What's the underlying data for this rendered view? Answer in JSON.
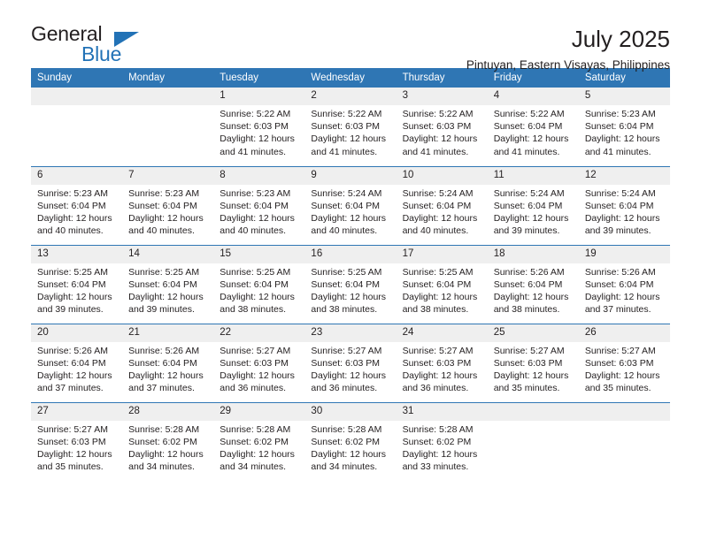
{
  "logo": {
    "text_top": "General",
    "text_bottom": "Blue",
    "icon": "triangle-icon",
    "color_primary": "#2272b6",
    "color_text": "#231f20"
  },
  "header": {
    "title": "July 2025",
    "subtitle": "Pintuyan, Eastern Visayas, Philippines"
  },
  "colors": {
    "header_row_bg": "#2f76b4",
    "daynum_bg": "#efefef",
    "row_divider": "#2f76b4",
    "text": "#231f20"
  },
  "weekday_headers": [
    "Sunday",
    "Monday",
    "Tuesday",
    "Wednesday",
    "Thursday",
    "Friday",
    "Saturday"
  ],
  "weeks": [
    [
      {
        "day": "",
        "info": ""
      },
      {
        "day": "",
        "info": ""
      },
      {
        "day": "1",
        "info": "Sunrise: 5:22 AM\nSunset: 6:03 PM\nDaylight: 12 hours\nand 41 minutes."
      },
      {
        "day": "2",
        "info": "Sunrise: 5:22 AM\nSunset: 6:03 PM\nDaylight: 12 hours\nand 41 minutes."
      },
      {
        "day": "3",
        "info": "Sunrise: 5:22 AM\nSunset: 6:03 PM\nDaylight: 12 hours\nand 41 minutes."
      },
      {
        "day": "4",
        "info": "Sunrise: 5:22 AM\nSunset: 6:04 PM\nDaylight: 12 hours\nand 41 minutes."
      },
      {
        "day": "5",
        "info": "Sunrise: 5:23 AM\nSunset: 6:04 PM\nDaylight: 12 hours\nand 41 minutes."
      }
    ],
    [
      {
        "day": "6",
        "info": "Sunrise: 5:23 AM\nSunset: 6:04 PM\nDaylight: 12 hours\nand 40 minutes."
      },
      {
        "day": "7",
        "info": "Sunrise: 5:23 AM\nSunset: 6:04 PM\nDaylight: 12 hours\nand 40 minutes."
      },
      {
        "day": "8",
        "info": "Sunrise: 5:23 AM\nSunset: 6:04 PM\nDaylight: 12 hours\nand 40 minutes."
      },
      {
        "day": "9",
        "info": "Sunrise: 5:24 AM\nSunset: 6:04 PM\nDaylight: 12 hours\nand 40 minutes."
      },
      {
        "day": "10",
        "info": "Sunrise: 5:24 AM\nSunset: 6:04 PM\nDaylight: 12 hours\nand 40 minutes."
      },
      {
        "day": "11",
        "info": "Sunrise: 5:24 AM\nSunset: 6:04 PM\nDaylight: 12 hours\nand 39 minutes."
      },
      {
        "day": "12",
        "info": "Sunrise: 5:24 AM\nSunset: 6:04 PM\nDaylight: 12 hours\nand 39 minutes."
      }
    ],
    [
      {
        "day": "13",
        "info": "Sunrise: 5:25 AM\nSunset: 6:04 PM\nDaylight: 12 hours\nand 39 minutes."
      },
      {
        "day": "14",
        "info": "Sunrise: 5:25 AM\nSunset: 6:04 PM\nDaylight: 12 hours\nand 39 minutes."
      },
      {
        "day": "15",
        "info": "Sunrise: 5:25 AM\nSunset: 6:04 PM\nDaylight: 12 hours\nand 38 minutes."
      },
      {
        "day": "16",
        "info": "Sunrise: 5:25 AM\nSunset: 6:04 PM\nDaylight: 12 hours\nand 38 minutes."
      },
      {
        "day": "17",
        "info": "Sunrise: 5:25 AM\nSunset: 6:04 PM\nDaylight: 12 hours\nand 38 minutes."
      },
      {
        "day": "18",
        "info": "Sunrise: 5:26 AM\nSunset: 6:04 PM\nDaylight: 12 hours\nand 38 minutes."
      },
      {
        "day": "19",
        "info": "Sunrise: 5:26 AM\nSunset: 6:04 PM\nDaylight: 12 hours\nand 37 minutes."
      }
    ],
    [
      {
        "day": "20",
        "info": "Sunrise: 5:26 AM\nSunset: 6:04 PM\nDaylight: 12 hours\nand 37 minutes."
      },
      {
        "day": "21",
        "info": "Sunrise: 5:26 AM\nSunset: 6:04 PM\nDaylight: 12 hours\nand 37 minutes."
      },
      {
        "day": "22",
        "info": "Sunrise: 5:27 AM\nSunset: 6:03 PM\nDaylight: 12 hours\nand 36 minutes."
      },
      {
        "day": "23",
        "info": "Sunrise: 5:27 AM\nSunset: 6:03 PM\nDaylight: 12 hours\nand 36 minutes."
      },
      {
        "day": "24",
        "info": "Sunrise: 5:27 AM\nSunset: 6:03 PM\nDaylight: 12 hours\nand 36 minutes."
      },
      {
        "day": "25",
        "info": "Sunrise: 5:27 AM\nSunset: 6:03 PM\nDaylight: 12 hours\nand 35 minutes."
      },
      {
        "day": "26",
        "info": "Sunrise: 5:27 AM\nSunset: 6:03 PM\nDaylight: 12 hours\nand 35 minutes."
      }
    ],
    [
      {
        "day": "27",
        "info": "Sunrise: 5:27 AM\nSunset: 6:03 PM\nDaylight: 12 hours\nand 35 minutes."
      },
      {
        "day": "28",
        "info": "Sunrise: 5:28 AM\nSunset: 6:02 PM\nDaylight: 12 hours\nand 34 minutes."
      },
      {
        "day": "29",
        "info": "Sunrise: 5:28 AM\nSunset: 6:02 PM\nDaylight: 12 hours\nand 34 minutes."
      },
      {
        "day": "30",
        "info": "Sunrise: 5:28 AM\nSunset: 6:02 PM\nDaylight: 12 hours\nand 34 minutes."
      },
      {
        "day": "31",
        "info": "Sunrise: 5:28 AM\nSunset: 6:02 PM\nDaylight: 12 hours\nand 33 minutes."
      },
      {
        "day": "",
        "info": ""
      },
      {
        "day": "",
        "info": ""
      }
    ]
  ]
}
